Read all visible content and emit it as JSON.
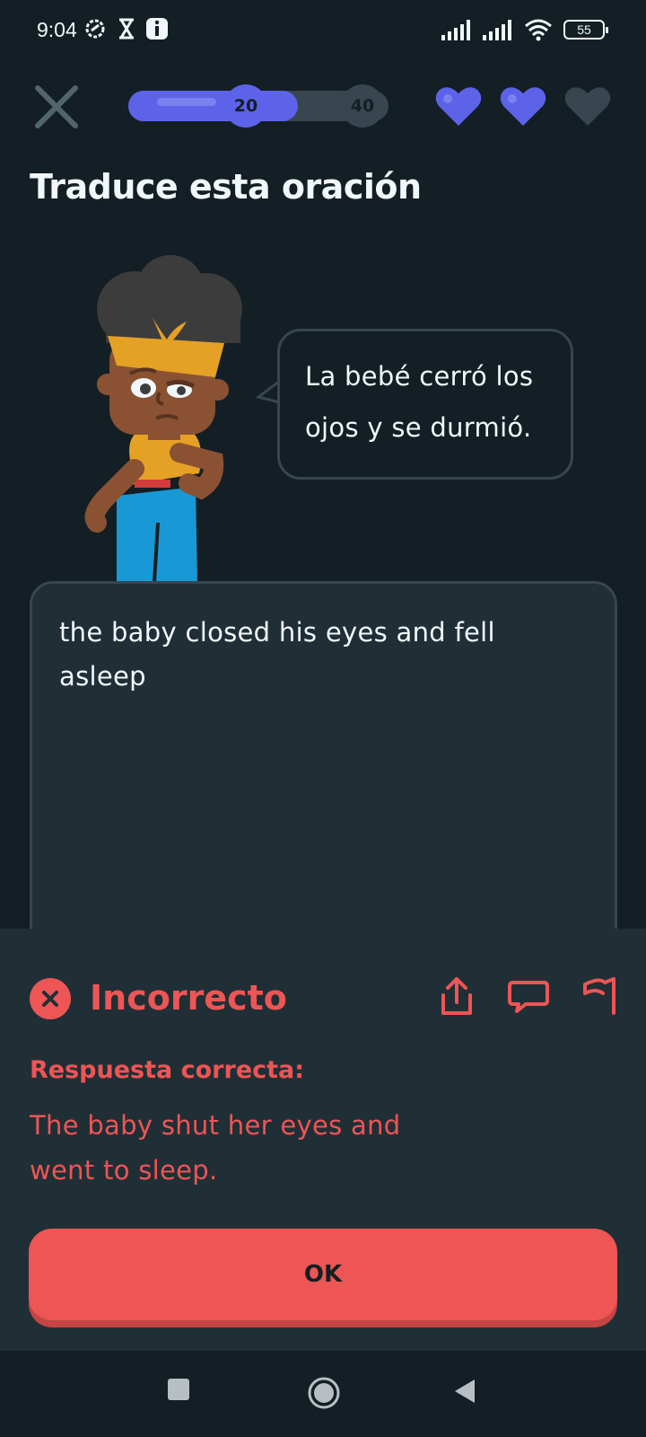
{
  "status_bar": {
    "time": "9:04",
    "battery": "55",
    "left_icons": [
      "settings-sync-icon",
      "hourglass-icon",
      "info-icon"
    ],
    "right_icons": [
      "signal-icon",
      "signal-icon",
      "wifi-icon",
      "battery-icon"
    ]
  },
  "header": {
    "progress": 0.65,
    "milestone_1": "20",
    "milestone_2": "40",
    "hearts_total": 3,
    "hearts_full": 2
  },
  "lesson": {
    "title": "Traduce esta oración",
    "prompt_line1": "La bebé cerró los",
    "prompt_line2": "ojos y se durmió.",
    "answer_line1": "the baby closed his eyes and fell",
    "answer_line2": "asleep"
  },
  "feedback": {
    "title": "Incorrecto",
    "label": "Respuesta correcta:",
    "answer_line1": "The baby shut her eyes and",
    "answer_line2": "went to sleep.",
    "ok_label": "OK",
    "actions": [
      "share-icon",
      "comment-icon",
      "report-flag-icon"
    ]
  },
  "colors": {
    "background": "#131f24",
    "panel": "#202f36",
    "border": "#37464f",
    "accent": "#5d63e8",
    "error": "#ee5555",
    "text": "#f1f7fb"
  }
}
